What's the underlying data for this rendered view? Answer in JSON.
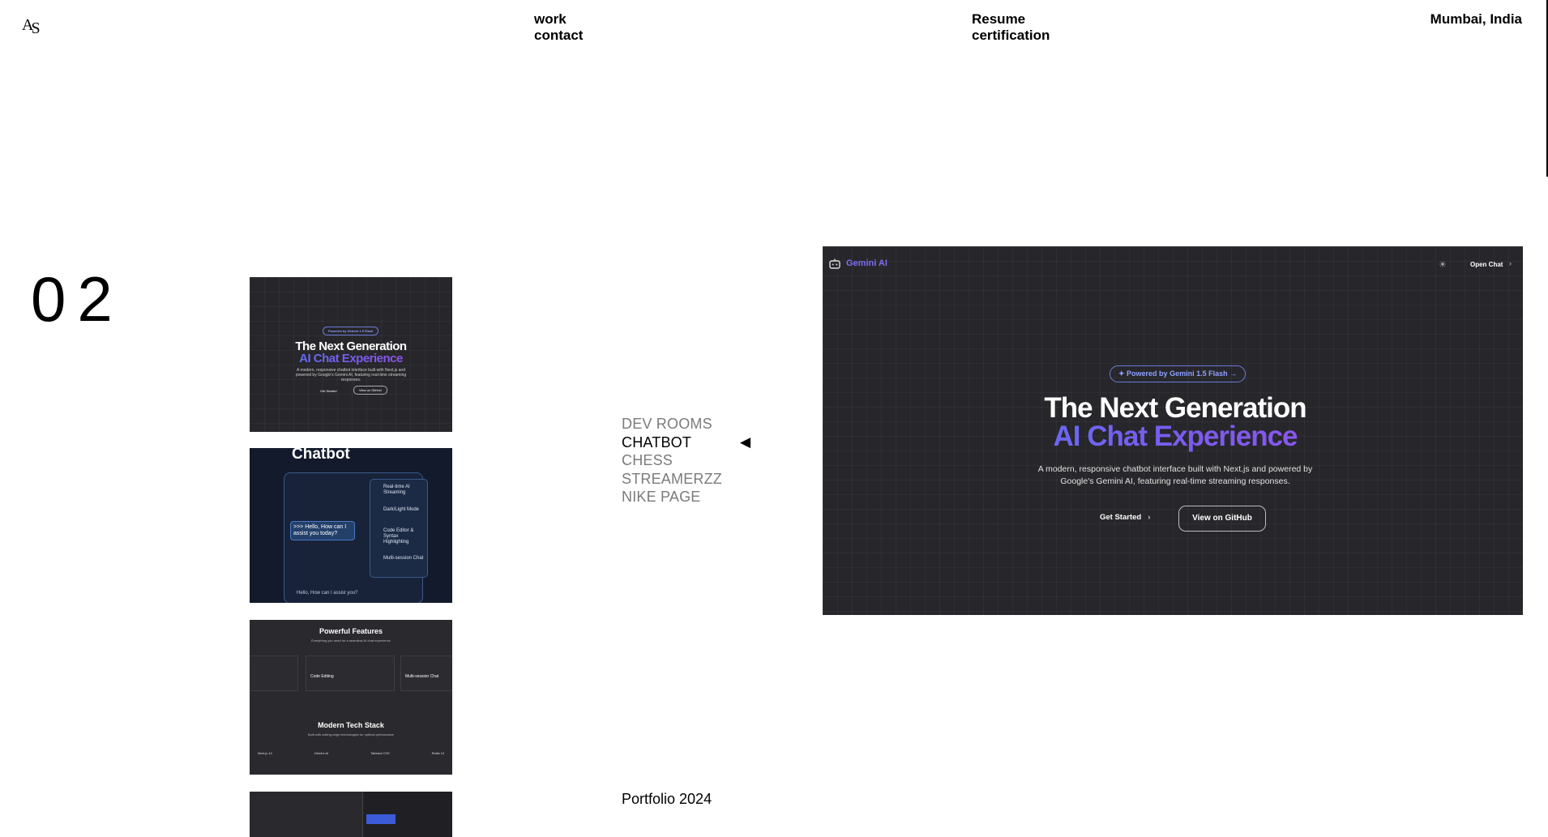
{
  "header": {
    "nav_left": [
      "work",
      "contact"
    ],
    "nav_right": [
      "Resume",
      "certification"
    ],
    "location": "Mumbai, India"
  },
  "section": {
    "number": "02"
  },
  "thumbnails": [
    {
      "pill": "Powered by Gemini 1.5 Flash",
      "title1": "The Next Generation",
      "title2": "AI Chat Experience",
      "desc": "A modern, responsive chatbot interface built with Next.js and powered by Google's Gemini AI, featuring real-time streaming responses.",
      "btn1": "Get Started",
      "btn2": "View on GitHub"
    },
    {
      "title": "Chatbot",
      "features": [
        "Real-time AI Streaming",
        "Dark/Light Mode",
        "Code Editor & Syntax Highlighting",
        "Multi-session Chat"
      ],
      "greeting": ">>> Hello, How can I assist you today?",
      "input_hint": "Hello, How can I assist you?"
    },
    {
      "heading1": "Powerful Features",
      "sub1": "Everything you need for a seamless AI chat experience",
      "cards": [
        "Code Editing",
        "Multi-session Chat"
      ],
      "heading2": "Modern Tech Stack",
      "sub2": "Built with cutting-edge technologies for optimal performance",
      "stack": [
        "Next.js 14",
        "Gemini AI",
        "Tailwind CSS",
        "Radix UI"
      ]
    },
    {}
  ],
  "projects": {
    "items": [
      "DEV ROOMS",
      "CHATBOT",
      "CHESS",
      "STREAMERZZ",
      "NIKE PAGE"
    ],
    "active_index": 1,
    "active_marker": "◀"
  },
  "footer": {
    "text": "Portfolio 2024"
  },
  "preview": {
    "brand": "Gemini AI",
    "open_chat": "Open Chat",
    "pill": "Powered by Gemini 1.5 Flash",
    "title1": "The Next Generation",
    "title2": "AI Chat Experience",
    "desc_line1": "A modern, responsive chatbot interface built with Next.js and powered by",
    "desc_line2": "Google's Gemini AI, featuring real-time streaming responses.",
    "btn_get_started": "Get Started",
    "btn_github": "View on GitHub"
  },
  "colors": {
    "accent": "#7a5cf0",
    "brand_blue": "#4c7cf6",
    "dark_bg": "#27272b"
  }
}
